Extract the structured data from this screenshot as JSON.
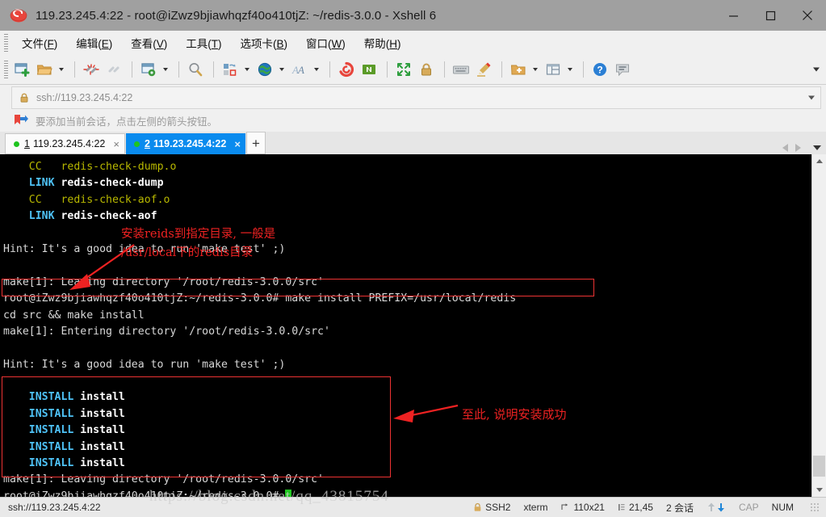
{
  "window": {
    "title": "119.23.245.4:22 - root@iZwz9bjiawhqzf40o410tjZ: ~/redis-3.0.0 - Xshell 6",
    "app_icon": "xshell-logo-icon",
    "minimize": "—",
    "maximize": "□",
    "close": "✕"
  },
  "menu": {
    "items": [
      {
        "label": "文件",
        "mnemonic": "F"
      },
      {
        "label": "编辑",
        "mnemonic": "E"
      },
      {
        "label": "查看",
        "mnemonic": "V"
      },
      {
        "label": "工具",
        "mnemonic": "T"
      },
      {
        "label": "选项卡",
        "mnemonic": "B"
      },
      {
        "label": "窗口",
        "mnemonic": "W"
      },
      {
        "label": "帮助",
        "mnemonic": "H"
      }
    ]
  },
  "toolbar": {
    "icons": [
      "new-session-icon",
      "open-folder-icon",
      "disconnect-icon",
      "reconnect-icon",
      "session-properties-icon",
      "find-icon",
      "transfer-file-icon",
      "web-browser-icon",
      "font-icon",
      "xshell-icon",
      "nethelper-icon",
      "fullscreen-icon",
      "lock-icon",
      "keyboard-icon",
      "highlight-icon",
      "add-folder-icon",
      "layout-icon",
      "help-icon",
      "chat-icon"
    ],
    "overflow": "toolbar-overflow-chevron"
  },
  "address_bar": {
    "lock_icon": "lock-icon",
    "value": "ssh://119.23.245.4:22",
    "dropdown_icon": "chevron-down-icon"
  },
  "notice": {
    "icon": "bookmark-arrow-icon",
    "text": "要添加当前会话，点击左侧的箭头按钮。"
  },
  "tabs": {
    "items": [
      {
        "number": "1",
        "label": "119.23.245.4:22",
        "active": false,
        "status": "connected",
        "close": "×"
      },
      {
        "number": "2",
        "label": "119.23.245.4:22",
        "active": true,
        "status": "connected",
        "close": "×"
      }
    ],
    "add_label": "+",
    "nav_prev_icon": "chevron-left-icon",
    "nav_next_icon": "chevron-right-icon",
    "nav_list_icon": "chevron-down-icon"
  },
  "terminal": {
    "lines": [
      {
        "indent": 4,
        "segs": [
          {
            "t": "CC",
            "c": "cc"
          },
          {
            "t": "   redis-check-dump.o",
            "c": "ccarg"
          }
        ]
      },
      {
        "indent": 4,
        "segs": [
          {
            "t": "LINK",
            "c": "link"
          },
          {
            "t": " redis-check-dump",
            "c": "bw"
          }
        ]
      },
      {
        "indent": 4,
        "segs": [
          {
            "t": "CC",
            "c": "cc"
          },
          {
            "t": "   redis-check-aof.o",
            "c": "ccarg"
          }
        ]
      },
      {
        "indent": 4,
        "segs": [
          {
            "t": "LINK",
            "c": "link"
          },
          {
            "t": " redis-check-aof",
            "c": "bw"
          }
        ]
      },
      {
        "indent": 0,
        "segs": []
      },
      {
        "indent": 0,
        "segs": [
          {
            "t": "Hint: It's a good idea to run 'make test' ;)",
            "c": "n"
          }
        ]
      },
      {
        "indent": 0,
        "segs": []
      },
      {
        "indent": 0,
        "segs": [
          {
            "t": "make[1]: Leaving directory '/root/redis-3.0.0/src'",
            "c": "n"
          }
        ]
      },
      {
        "indent": 0,
        "segs": [
          {
            "t": "root@iZwz9bjiawhqzf40o410tjZ:~/redis-3.0.0# make install PREFIX=/usr/local/redis",
            "c": "n"
          }
        ]
      },
      {
        "indent": 0,
        "segs": [
          {
            "t": "cd src && make install",
            "c": "n"
          }
        ]
      },
      {
        "indent": 0,
        "segs": [
          {
            "t": "make[1]: Entering directory '/root/redis-3.0.0/src'",
            "c": "n"
          }
        ]
      },
      {
        "indent": 0,
        "segs": []
      },
      {
        "indent": 0,
        "segs": [
          {
            "t": "Hint: It's a good idea to run 'make test' ;)",
            "c": "n"
          }
        ]
      },
      {
        "indent": 0,
        "segs": []
      },
      {
        "indent": 4,
        "segs": [
          {
            "t": "INSTALL",
            "c": "install"
          },
          {
            "t": " install",
            "c": "bw"
          }
        ]
      },
      {
        "indent": 4,
        "segs": [
          {
            "t": "INSTALL",
            "c": "install"
          },
          {
            "t": " install",
            "c": "bw"
          }
        ]
      },
      {
        "indent": 4,
        "segs": [
          {
            "t": "INSTALL",
            "c": "install"
          },
          {
            "t": " install",
            "c": "bw"
          }
        ]
      },
      {
        "indent": 4,
        "segs": [
          {
            "t": "INSTALL",
            "c": "install"
          },
          {
            "t": " install",
            "c": "bw"
          }
        ]
      },
      {
        "indent": 4,
        "segs": [
          {
            "t": "INSTALL",
            "c": "install"
          },
          {
            "t": " install",
            "c": "bw"
          }
        ]
      },
      {
        "indent": 0,
        "segs": [
          {
            "t": "make[1]: Leaving directory '/root/redis-3.0.0/src'",
            "c": "n"
          }
        ]
      },
      {
        "indent": 0,
        "segs": [
          {
            "t": "root@iZwz9bjiawhqzf40o410tjZ:~/redis-3.0.0# ",
            "c": "n"
          }
        ],
        "cursor": true
      }
    ],
    "annotations": [
      {
        "name": "annotation-install-prefix",
        "text": "安装reids到指定目录, 一般是\n/usr/local下的redis目录"
      },
      {
        "name": "annotation-install-success",
        "text": "至此, 说明安装成功"
      }
    ],
    "highlight_color": "#ee2222"
  },
  "scrollbar": {
    "up_icon": "chevron-up-icon",
    "down_icon": "chevron-down-icon"
  },
  "status_bar": {
    "connection": "ssh://119.23.245.4:22",
    "protocol": "SSH2",
    "terminal_type": "xterm",
    "size": "110x21",
    "cursor_pos": "21,45",
    "sessions": "2 会话",
    "cap": "CAP",
    "num": "NUM",
    "lock_icon": "lock-icon",
    "size_icon": "resize-icon",
    "cursor_icon": "cursor-pos-icon",
    "up_icon": "upload-arrow-icon",
    "down_icon": "download-arrow-icon",
    "watermark": "https://blog.csdn.net/qq_43815754"
  }
}
